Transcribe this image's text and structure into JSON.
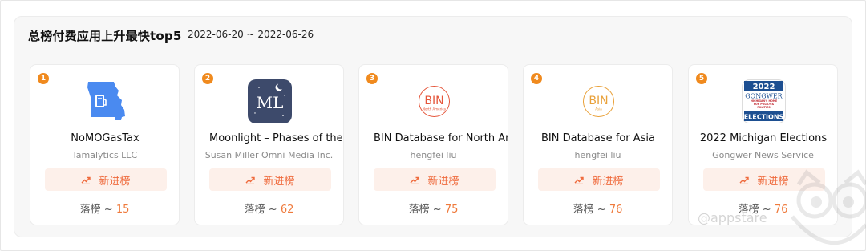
{
  "header": {
    "title": "总榜付费应用上升最快top5",
    "date_range": "2022-06-20 ~ 2022-06-26"
  },
  "badge_label": "新进榜",
  "drop_label": "落榜 ~",
  "apps": [
    {
      "rank": "1",
      "name": "NoMOGasTax",
      "developer": "Tamalytics LLC",
      "drop_rank": "15",
      "icon": "missouri-gas-icon"
    },
    {
      "rank": "2",
      "name": "Moonlight – Phases of the Moon",
      "developer": "Susan Miller Omni Media Inc.",
      "drop_rank": "62",
      "icon": "moonlight-icon",
      "icon_text": "ML"
    },
    {
      "rank": "3",
      "name": "BIN Database for North America",
      "developer": "hengfei liu",
      "drop_rank": "75",
      "icon": "bin-north-america-icon",
      "icon_text": "BIN",
      "icon_sub": "North America"
    },
    {
      "rank": "4",
      "name": "BIN Database for Asia",
      "developer": "hengfei liu",
      "drop_rank": "76",
      "icon": "bin-asia-icon",
      "icon_text": "BIN",
      "icon_sub": "Asia"
    },
    {
      "rank": "5",
      "name": "2022 Michigan Elections",
      "developer": "Gongwer News Service",
      "drop_rank": "76",
      "icon": "gongwer-elections-icon",
      "icon_text": "2022",
      "icon_brand": "GONGWER",
      "icon_tag": "MICHIGAN'S HOME FOR POLICY & POLITICS",
      "icon_footer": "ELECTIONS"
    }
  ],
  "watermark": "@appstare",
  "colors": {
    "accent": "#ef6a3c",
    "rank_badge": "#f08a1e",
    "badge_bg": "#fdf0ea",
    "moon_bg": "#3d4a6b",
    "bin_na": "#e5553a",
    "bin_asia": "#e9a13a",
    "gongwer_blue": "#1d4f91",
    "gongwer_red": "#c0262f"
  }
}
